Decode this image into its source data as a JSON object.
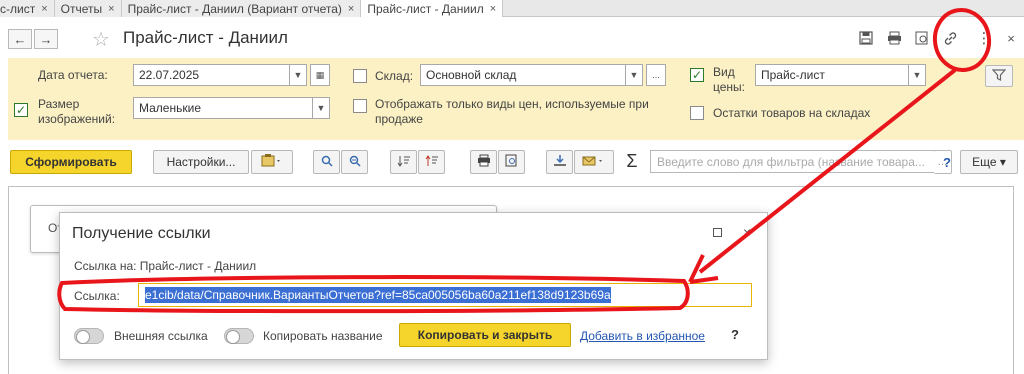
{
  "tabs": [
    {
      "label": "с-лист",
      "close": "×"
    },
    {
      "label": "Отчеты",
      "close": "×"
    },
    {
      "label": "Прайс-лист - Даниил (Вариант отчета)",
      "close": "×"
    },
    {
      "label": "Прайс-лист - Даниил",
      "close": "×"
    }
  ],
  "header": {
    "back": "←",
    "forward": "→",
    "title": "Прайс-лист - Даниил",
    "more": "⋮",
    "close": "×"
  },
  "settings": {
    "report_date_label": "Дата отчета:",
    "report_date_value": "22.07.2025",
    "image_size_label_1": "Размер",
    "image_size_label_2": "изображений:",
    "image_size_value": "Маленькие",
    "image_size_checked": "✓",
    "warehouse_label": "Склад:",
    "warehouse_value": "Основной склад",
    "warehouse_ellipsis": "...",
    "price_types_label_1": "Отображать только виды цен, используемые при",
    "price_types_label_2": "продаже",
    "price_kind_label_1": "Вид",
    "price_kind_label_2": "цены:",
    "price_kind_value": "Прайс-лист",
    "price_kind_checked": "✓",
    "stock_label": "Остатки товаров на складах"
  },
  "toolbar": {
    "generate": "Сформировать",
    "settings": "Настройки...",
    "search_placeholder": "Введите слово для фильтра (название товара...",
    "help": "?",
    "more": "Еще ▾"
  },
  "background": {
    "text": "От"
  },
  "dialog": {
    "title": "Получение ссылки",
    "link_to_label": "Ссылка на: Прайс-лист - Даниил",
    "link_label": "Ссылка:",
    "link_value": "e1cib/data/Справочник.ВариантыОтчетов?ref=85ca005056ba60a211ef138d9123b69a",
    "external_link": "Внешняя ссылка",
    "copy_name": "Копировать название",
    "copy_close": "Копировать и закрыть",
    "add_favorite": "Добавить в избранное",
    "help": "?",
    "close": "×"
  },
  "colors": {
    "panel_bg": "#fbf1c5",
    "primary_button": "#f5d42c",
    "annotation_red": "#e8161b",
    "selection_blue": "#3b6fd4"
  }
}
